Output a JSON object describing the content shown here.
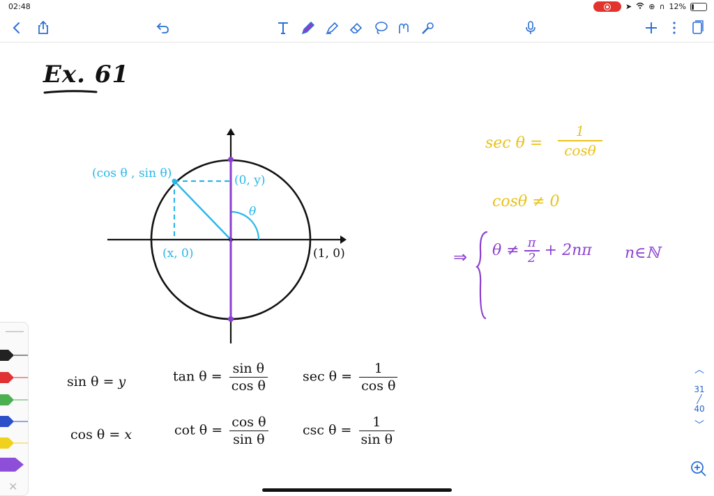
{
  "status_bar": {
    "time": "02:48",
    "battery": "12%"
  },
  "toolbar": {
    "icons": [
      "back-icon",
      "share-icon",
      "undo-icon",
      "text-tool-icon",
      "pen-tool-icon",
      "highlighter-icon",
      "eraser-icon",
      "lasso-icon",
      "shape-tool-icon",
      "laser-pointer-icon",
      "microphone-icon",
      "add-icon",
      "more-icon",
      "pages-icon"
    ]
  },
  "note": {
    "heading": "Ex. 61",
    "diagram": {
      "point_label": "(cos θ , sin θ)",
      "y_point_label": "(0, y)",
      "x_point_label": "(x, 0)",
      "unit_label": "(1, 0)",
      "angle_label": "θ"
    },
    "identities": {
      "sin": {
        "lhs": "sin θ = ",
        "rhs": "y"
      },
      "cos": {
        "lhs": "cos θ = ",
        "rhs": "x"
      },
      "tan": {
        "lhs": "tan θ = ",
        "num": "sin θ",
        "den": "cos θ"
      },
      "cot": {
        "lhs": "cot θ = ",
        "num": "cos θ",
        "den": "sin θ"
      },
      "sec": {
        "lhs": "sec θ = ",
        "num": "1",
        "den": "cos θ"
      },
      "csc": {
        "lhs": "csc θ = ",
        "num": "1",
        "den": "sin θ"
      }
    },
    "handwriting": {
      "sec_lhs": "sec θ =",
      "sec_num": "1",
      "sec_den": "cosθ",
      "condition": "cosθ ≠ 0",
      "implies": "⇒",
      "case1": "θ ≠",
      "pi": "π",
      "two": "2",
      "case1_tail": "+ 2nπ",
      "domain": "n∈ℕ"
    }
  },
  "pen_colors": [
    "#222222",
    "#e03232",
    "#4caf50",
    "#2a4fc8",
    "#f0d21e",
    "#8e4fd8"
  ],
  "page_nav": {
    "current": "31",
    "total": "40"
  },
  "colors": {
    "accent": "#2b6fd6",
    "diagram_blue": "#29b6e8",
    "purple": "#8a3fd1",
    "gold": "#e9c21a"
  }
}
